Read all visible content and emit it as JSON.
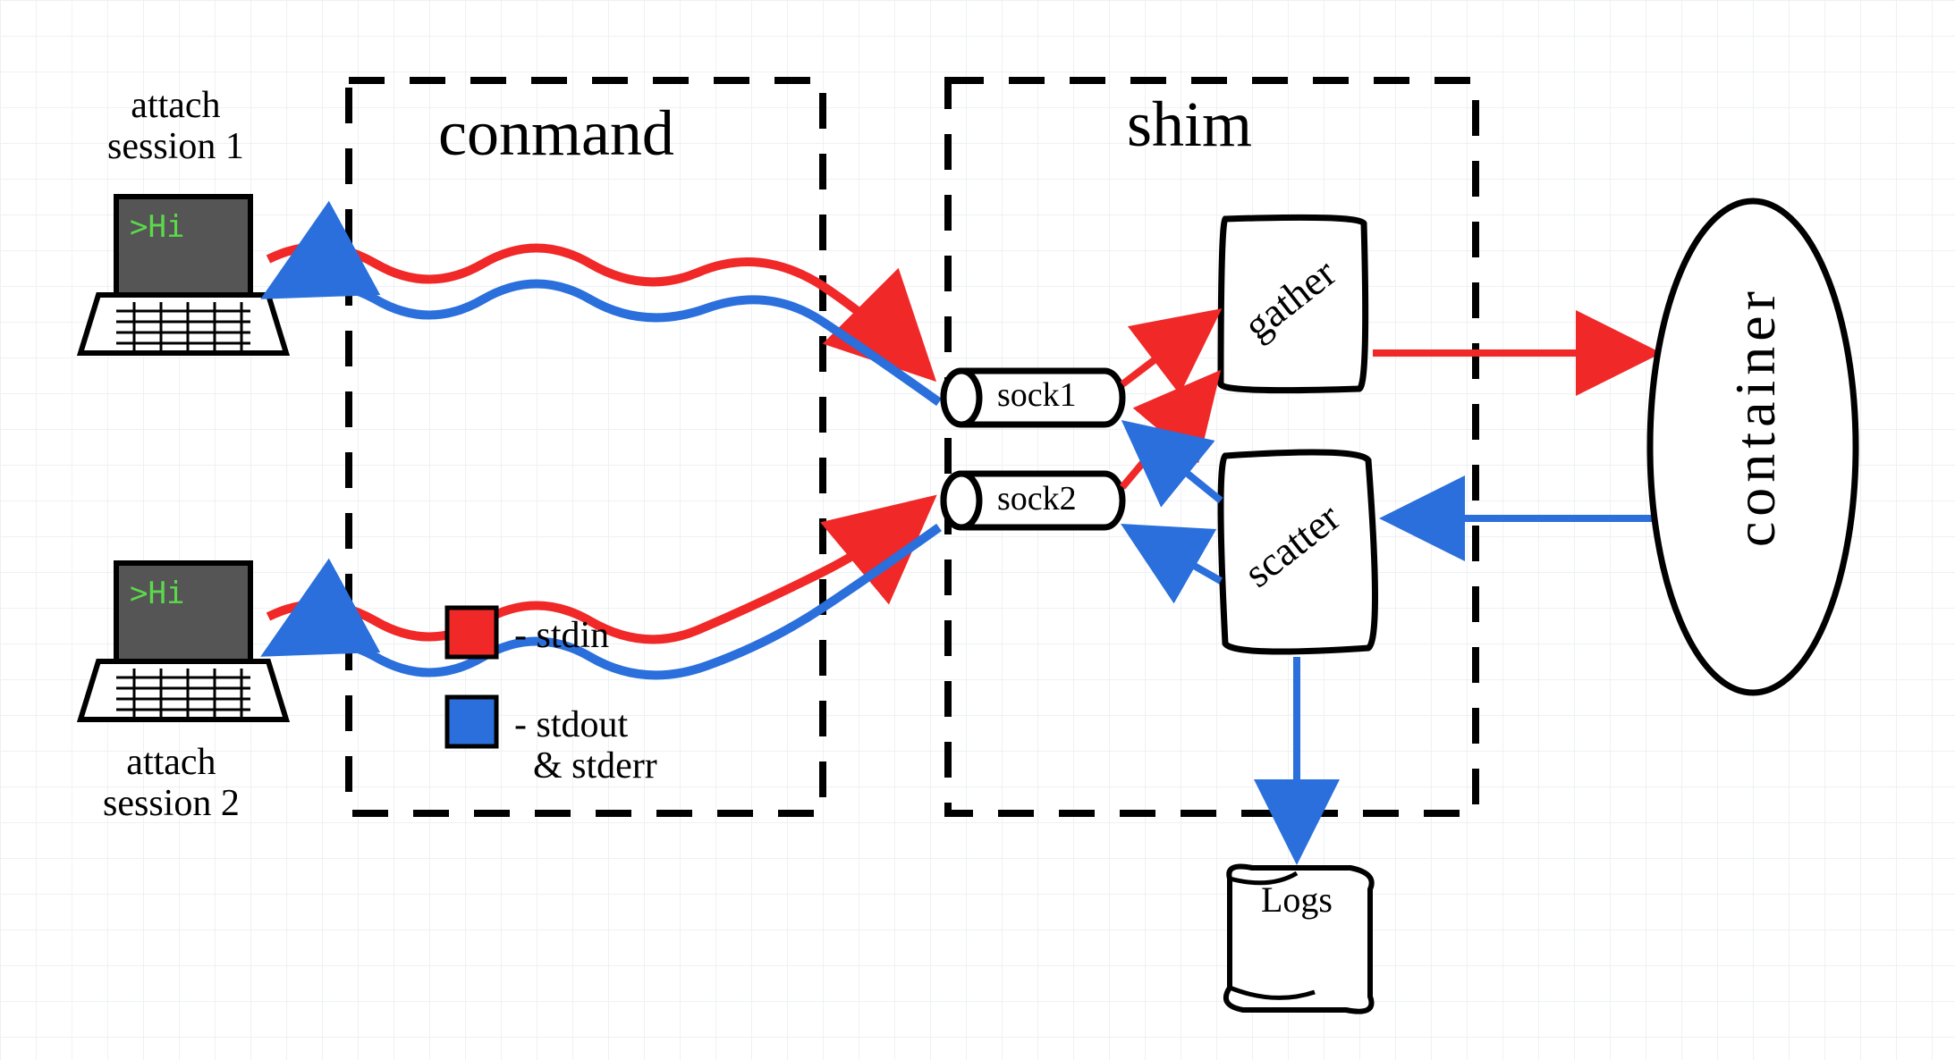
{
  "sessions": {
    "s1": {
      "label": "attach\nsession 1",
      "prompt": ">Hi"
    },
    "s2": {
      "label": "attach\nsession 2",
      "prompt": ">Hi"
    }
  },
  "boxes": {
    "conmand": "conmand",
    "shim": "shim",
    "gather": "gather",
    "scatter": "scatter",
    "logs": "Logs",
    "container": "container"
  },
  "sockets": {
    "sock1": "sock1",
    "sock2": "sock2"
  },
  "legend": {
    "stdin": "- stdin",
    "stdout": "- stdout\n  & stderr"
  },
  "colors": {
    "stdin": "#f02828",
    "stdout": "#2a6fdc",
    "ink": "#000"
  }
}
